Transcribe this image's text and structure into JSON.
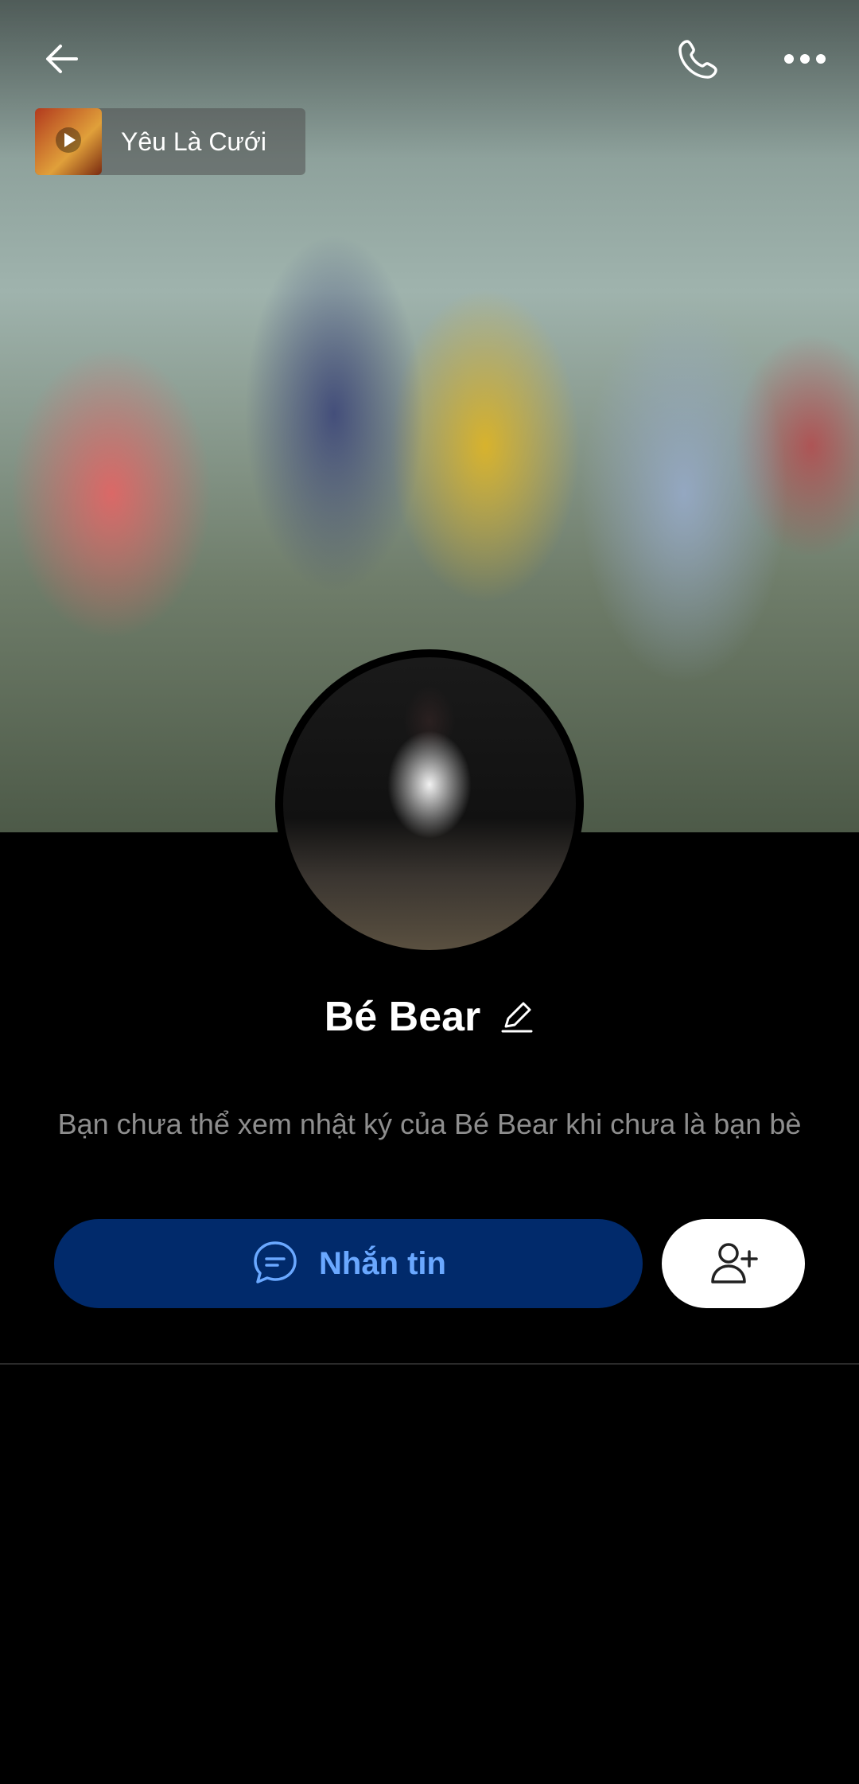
{
  "header": {
    "back_icon": "back-arrow-icon",
    "call_icon": "phone-icon",
    "more_icon": "more-icon"
  },
  "music": {
    "title": "Yêu Là Cưới",
    "thumb_icon": "play-icon"
  },
  "profile": {
    "name": "Bé Bear",
    "edit_icon": "pencil-icon",
    "notice": "Bạn chưa thể xem nhật ký của Bé Bear khi chưa là bạn bè"
  },
  "actions": {
    "message_label": "Nhắn tin",
    "message_icon": "chat-bubble-icon",
    "add_friend_icon": "add-friend-icon"
  },
  "colors": {
    "background": "#000000",
    "message_button_bg": "#012a6b",
    "message_button_text": "#6aa8ff",
    "notice_text": "#8e8e8e"
  }
}
